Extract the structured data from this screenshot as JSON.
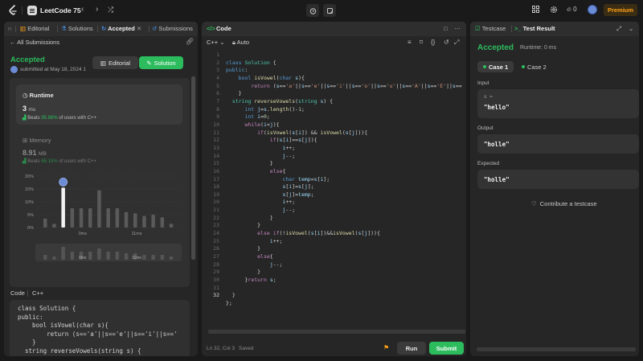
{
  "topbar": {
    "title": "LeetCode 75",
    "prev": "‹",
    "next": "›",
    "shuffle": "⤮",
    "streak": "0",
    "premium": "Premium"
  },
  "left": {
    "tabs": [
      "Editorial",
      "Solutions",
      "Accepted",
      "Submissions"
    ],
    "back_label": "All Submissions",
    "status": "Accepted",
    "submitted": "submitted at May 18, 2024 1",
    "editorial_btn": "Editorial",
    "solution_btn": "Solution",
    "runtime_label": "Runtime",
    "runtime_value": "3",
    "runtime_unit": "ms",
    "runtime_beats_prefix": "Beats",
    "runtime_beats_pct": "95.88%",
    "runtime_beats_suffix": "of users with C++",
    "memory_label": "Memory",
    "memory_value": "8.91",
    "memory_unit": "MB",
    "memory_beats_prefix": "Beats",
    "memory_beats_pct": "65.15%",
    "memory_beats_suffix": "of users with C++",
    "code_label": "Code",
    "code_lang": "C++",
    "snippet_lines": [
      "class Solution {",
      "public:",
      "    bool isVowel(char s){",
      "        return (s=='a'||s=='e'||s=='i'||s=='",
      "    }",
      "  string reverseVowels(string s) {"
    ]
  },
  "chart_data": {
    "type": "bar",
    "yticks": [
      "20%",
      "15%",
      "10%",
      "5%",
      "0%"
    ],
    "ylim": [
      0,
      20
    ],
    "xticks": [
      "0ms",
      "11ms"
    ],
    "values": [
      3.5,
      1.5,
      15.5,
      7.5,
      7.5,
      7.5,
      14.5,
      7.5,
      7.5,
      6,
      5.5,
      4.5,
      5,
      4,
      1.5
    ],
    "highlight_index": 2,
    "mini_values": [
      3,
      2,
      8,
      5,
      5,
      5,
      7,
      5,
      5,
      4,
      4,
      3,
      3,
      3,
      2
    ],
    "mini_xticks": [
      "0ms",
      "11ms"
    ]
  },
  "mid": {
    "title": "Code",
    "lang": "C++",
    "auto": "Auto",
    "status": "Ln 32, Col 3",
    "saved": "Saved",
    "run": "Run",
    "submit": "Submit"
  },
  "right": {
    "tabs": [
      "Testcase",
      "Test Result"
    ],
    "status": "Accepted",
    "runtime": "Runtime: 0 ms",
    "cases": [
      "Case 1",
      "Case 2"
    ],
    "input_label": "Input",
    "input_var": "s =",
    "input_val": "\"hello\"",
    "output_label": "Output",
    "output_val": "\"holle\"",
    "expected_label": "Expected",
    "expected_val": "\"holle\"",
    "contribute": "Contribute a testcase"
  },
  "colors": {
    "accent_green": "#2cbb5d",
    "premium": "#ffa116",
    "panel": "#262626",
    "background": "#1a1a1a"
  }
}
